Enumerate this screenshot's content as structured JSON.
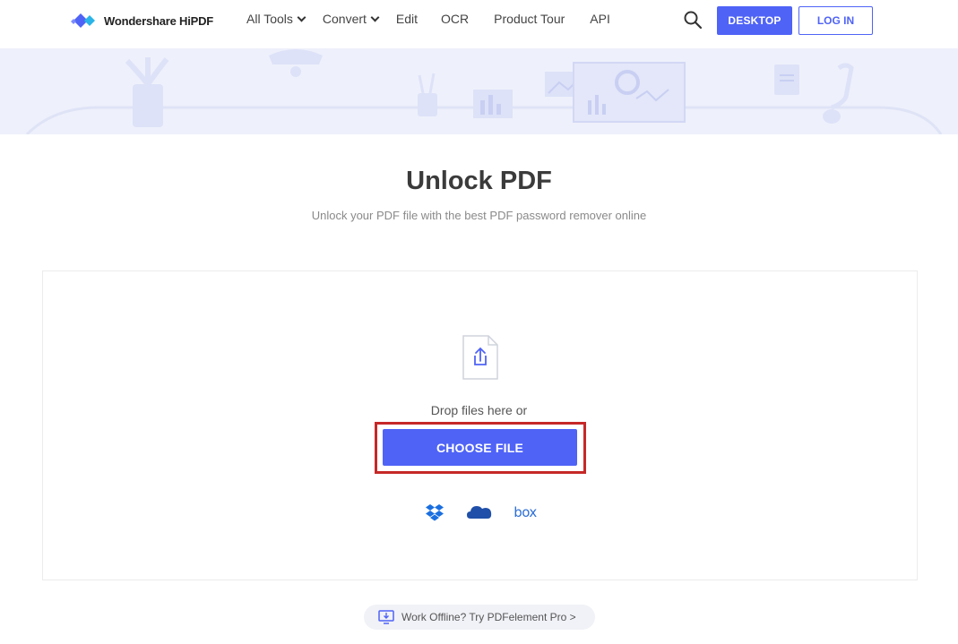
{
  "brand": {
    "name": "Wondershare HiPDF",
    "accent": "#4f63f6",
    "highlight": "#c62828"
  },
  "nav": {
    "items": [
      {
        "label": "All Tools",
        "dropdown": true
      },
      {
        "label": "Convert",
        "dropdown": true
      },
      {
        "label": "Edit",
        "dropdown": false
      },
      {
        "label": "OCR",
        "dropdown": false
      },
      {
        "label": "Product Tour",
        "dropdown": false
      },
      {
        "label": "API",
        "dropdown": false
      }
    ],
    "search_icon": "search-icon",
    "desktop_label": "DESKTOP",
    "login_label": "LOG IN"
  },
  "main": {
    "title": "Unlock PDF",
    "subtitle": "Unlock your PDF file with the best PDF password remover online",
    "upload_icon": "file-upload-icon",
    "drop_text": "Drop files here or",
    "choose_label": "CHOOSE FILE",
    "cloud_sources": [
      "dropbox-icon",
      "onedrive-icon",
      "box-icon"
    ],
    "box_text": "box"
  },
  "footer": {
    "offline_icon": "desktop-download-icon",
    "offline_text": "Work Offline? Try PDFelement Pro >"
  }
}
